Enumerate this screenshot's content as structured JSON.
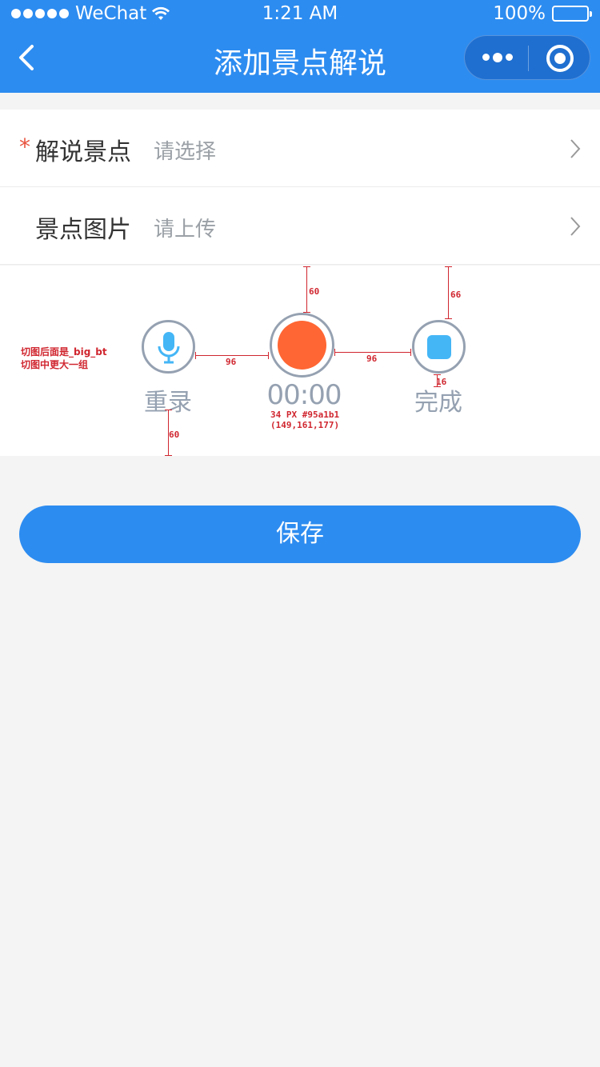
{
  "status_bar": {
    "carrier": "WeChat",
    "time": "1:21 AM",
    "battery": "100%"
  },
  "nav": {
    "title": "添加景点解说"
  },
  "form": {
    "rows": [
      {
        "required_mark": "*",
        "label": "解说景点",
        "value": "请选择"
      },
      {
        "label": "景点图片",
        "value": "请上传"
      }
    ]
  },
  "recorder": {
    "rerecord_label": "重录",
    "timer": "00:00",
    "done_label": "完成"
  },
  "annotations": {
    "note_line1": "切图后面是_big_bt",
    "note_line2": "切图中更大一组",
    "dim_top_center": "60",
    "dim_top_right": "66",
    "dim_gap_left": "96",
    "dim_gap_right": "96",
    "dim_label_gap": "16",
    "dim_bottom_left": "60",
    "font_spec": "34 PX  #95a1b1",
    "font_rgb": "(149,161,177)"
  },
  "colors": {
    "primary": "#2d8cf0",
    "record": "#ff6633",
    "stop": "#44b6f6",
    "muted": "#95a1b1"
  },
  "actions": {
    "save_label": "保存"
  }
}
